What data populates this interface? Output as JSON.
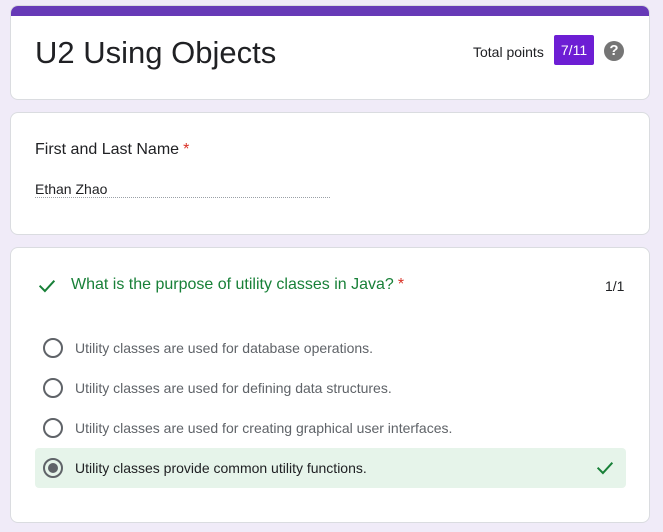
{
  "form": {
    "title": "U2 Using Objects",
    "total_points_label": "Total points",
    "score": "7/11",
    "help_icon": "help-circle-icon",
    "accent_color": "#673ab7"
  },
  "name_question": {
    "label": "First and Last Name",
    "required_mark": "*",
    "answer": "Ethan Zhao"
  },
  "question": {
    "status_icon": "check-icon",
    "status_color": "#188038",
    "title": "What is the purpose of utility classes in Java?",
    "required_mark": "*",
    "score": "1/1",
    "options": [
      {
        "label": "Utility classes are used for database operations.",
        "selected": false
      },
      {
        "label": "Utility classes are used for defining data structures.",
        "selected": false
      },
      {
        "label": "Utility classes are used for creating graphical user interfaces.",
        "selected": false
      },
      {
        "label": "Utility classes provide common utility functions.",
        "selected": true,
        "correct": true
      }
    ]
  }
}
